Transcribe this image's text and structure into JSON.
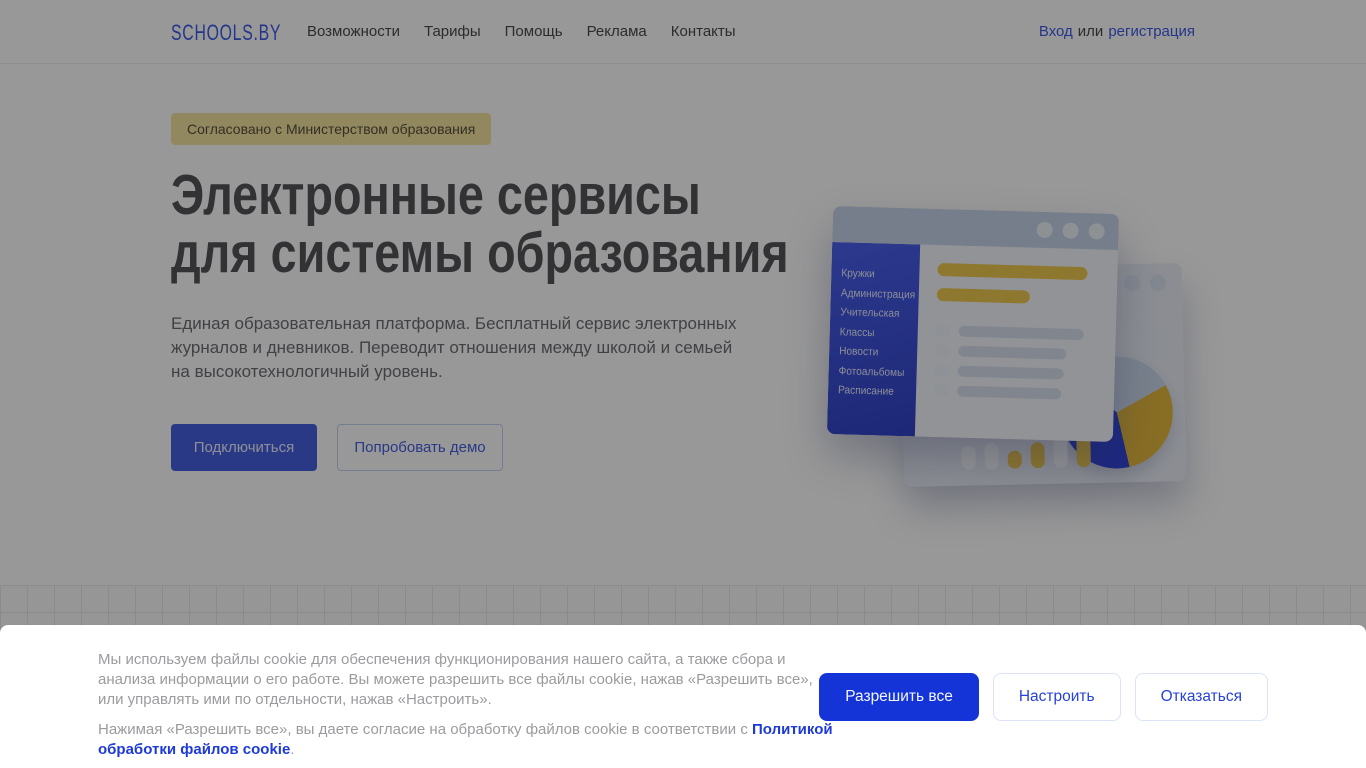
{
  "header": {
    "logo": "SCHOOLS.BY",
    "nav": [
      "Возможности",
      "Тарифы",
      "Помощь",
      "Реклама",
      "Контакты"
    ],
    "auth": {
      "login": "Вход",
      "separator": "или",
      "register": "регистрация"
    }
  },
  "hero": {
    "badge": "Согласовано с Министерством образования",
    "title_line1": "Электронные сервисы",
    "title_line2": "для системы образования",
    "description": "Единая образовательная платформа. Бесплатный сервис электронных журналов и дневников. Переводит отношения между школой и семьей на высокотехнологичный уровень.",
    "primary_button": "Подключиться",
    "secondary_button": "Попробовать демо"
  },
  "illustration": {
    "menu": [
      "Кружки",
      "Администрация",
      "Учительская",
      "Классы",
      "Новости",
      "Фотоальбомы",
      "Расписание"
    ]
  },
  "cookie_banner": {
    "paragraph1": "Мы используем файлы cookie для обеспечения функционирования нашего сайта, а также сбора и анализа информации о его работе. Вы можете разрешить все файлы cookie, нажав «Разрешить все», или управлять ими по отдельности, нажав «Настроить».",
    "paragraph2_prefix": "Нажимая «Разрешить все», вы даете согласие на обработку файлов cookie в соответствии с ",
    "policy_link": "Политикой обработки файлов cookie",
    "paragraph2_suffix": ".",
    "allow_all_button": "Разрешить все",
    "configure_button": "Настроить",
    "decline_button": "Отказаться"
  },
  "colors": {
    "brand_blue": "#3D5BE8",
    "accent_blue": "#1434D8",
    "badge_yellow": "#F5E4A1",
    "illustration_yellow": "#EFC94F",
    "sidebar_blue": "#3E52DC"
  }
}
